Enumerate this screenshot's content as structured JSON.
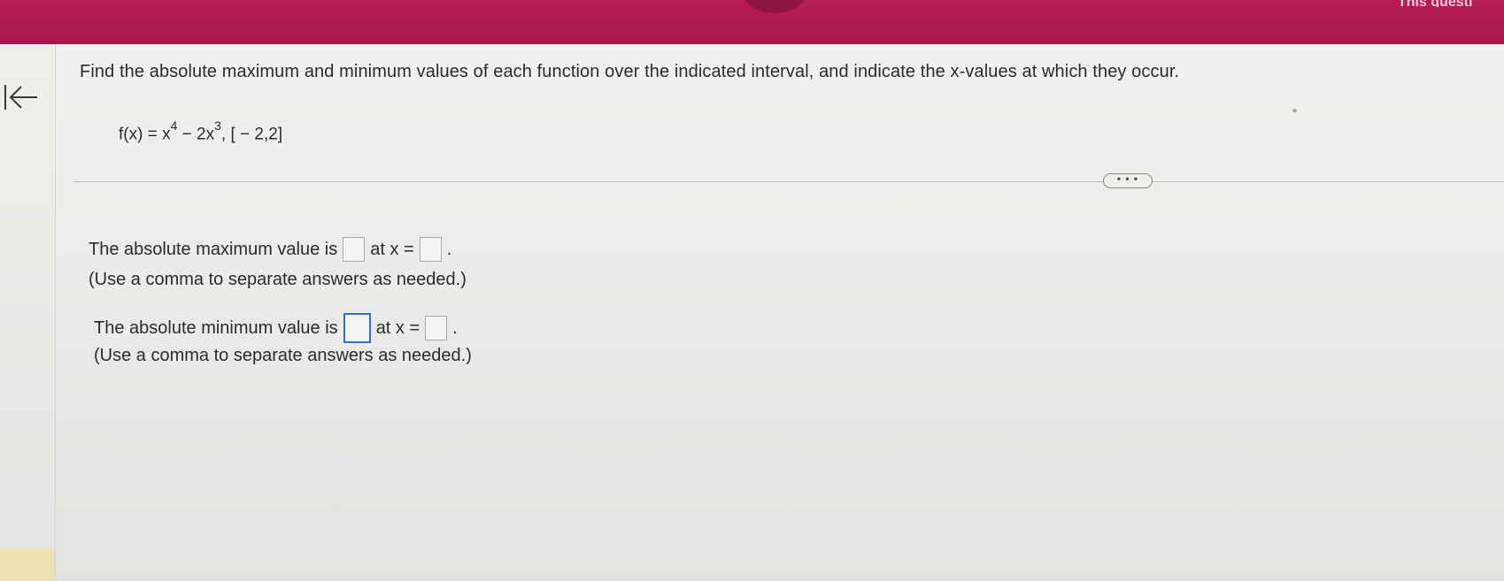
{
  "header": {
    "corner_text": "This questi"
  },
  "navigation": {
    "back_icon": "arrow-left-bar-icon"
  },
  "question": {
    "prompt": "Find the absolute maximum and minimum values of each function over the indicated interval, and indicate the x-values at which they occur.",
    "function_lhs": "f(x) = x",
    "exp1": "4",
    "term2": " − 2x",
    "exp2": "3",
    "interval": ", [ − 2,2]"
  },
  "more_button_label": "• • •",
  "answers": {
    "max_line_prefix": "The absolute maximum value is",
    "max_line_at": "at x =",
    "max_line_suffix": ".",
    "max_note": "(Use a comma to separate answers as needed.)",
    "min_line_prefix": "The absolute minimum value is",
    "min_line_at": "at x =",
    "min_line_suffix": ".",
    "min_note": "(Use a comma to separate answers as needed.)",
    "max_value": "",
    "max_x": "",
    "min_value": "",
    "min_x": ""
  },
  "colors": {
    "header_bar": "#b71c56",
    "active_input_border": "#2f6fc4"
  }
}
